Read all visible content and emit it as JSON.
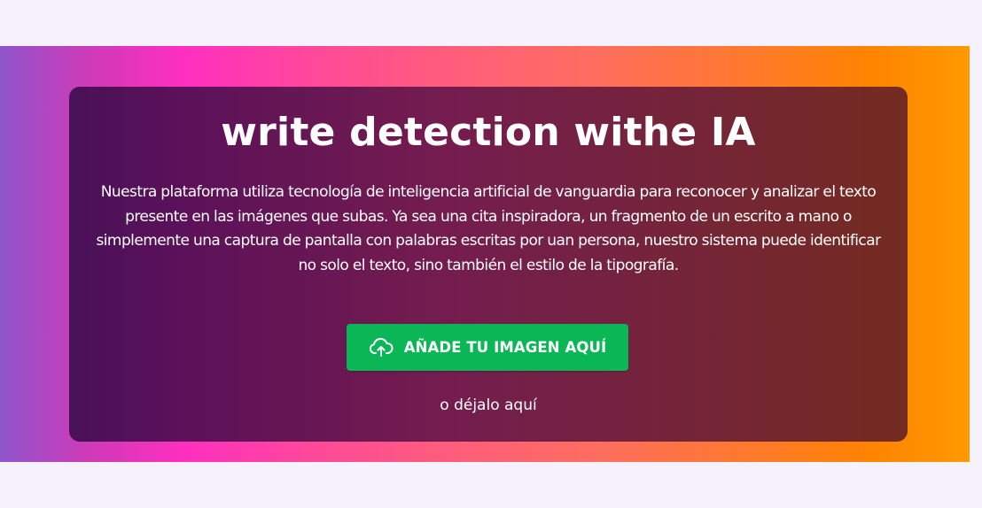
{
  "hero": {
    "title": "write detection withe IA",
    "description": "Nuestra plataforma utiliza tecnología de inteligencia artificial de vanguardia para reconocer y analizar el texto presente en las imágenes que subas. Ya sea una cita inspiradora, un fragmento de un escrito a mano o simplemente una captura de pantalla con palabras escritas por uan persona, nuestro sistema puede identificar no solo el texto, sino también el estilo de la tipografía.",
    "upload_button_label": "AÑADE TU IMAGEN AQUÍ",
    "upload_icon": "cloud-upload-icon",
    "drop_hint": "o déjalo aquí"
  },
  "colors": {
    "page_background": "#f6f2fd",
    "gradient_stops": [
      "#8f55cc",
      "#ff2fc0",
      "#ff5f78",
      "#ff8400",
      "#ff9a00"
    ],
    "card_background": "#4a0f48",
    "button_background": "#0ab656",
    "text": "#ffffff"
  }
}
